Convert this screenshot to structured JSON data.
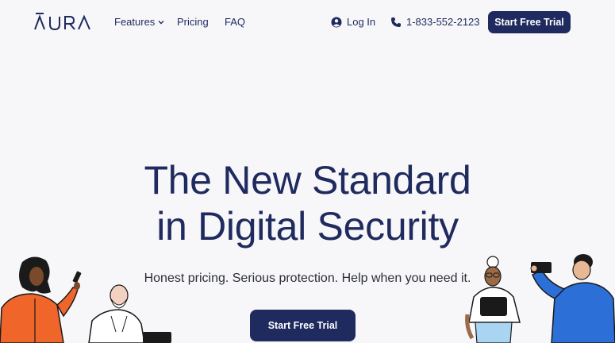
{
  "brand": {
    "logo_text": "AURA"
  },
  "nav": {
    "features_label": "Features",
    "pricing_label": "Pricing",
    "faq_label": "FAQ",
    "login_label": "Log In",
    "phone_label": "1-833-552-2123",
    "cta_label": "Start Free Trial"
  },
  "hero": {
    "title_line1": "The New Standard",
    "title_line2": "in Digital Security",
    "subtitle": "Honest pricing. Serious protection. Help when you need it.",
    "cta_label": "Start Free Trial"
  },
  "icons": {
    "features_chevron": "chevron-down-icon",
    "login": "user-circle-icon",
    "phone": "phone-icon"
  },
  "colors": {
    "brand_navy": "#1f2a5e",
    "background": "#f7f7f9",
    "illustration_orange": "#f0652a",
    "illustration_blue": "#2c6fd6"
  }
}
